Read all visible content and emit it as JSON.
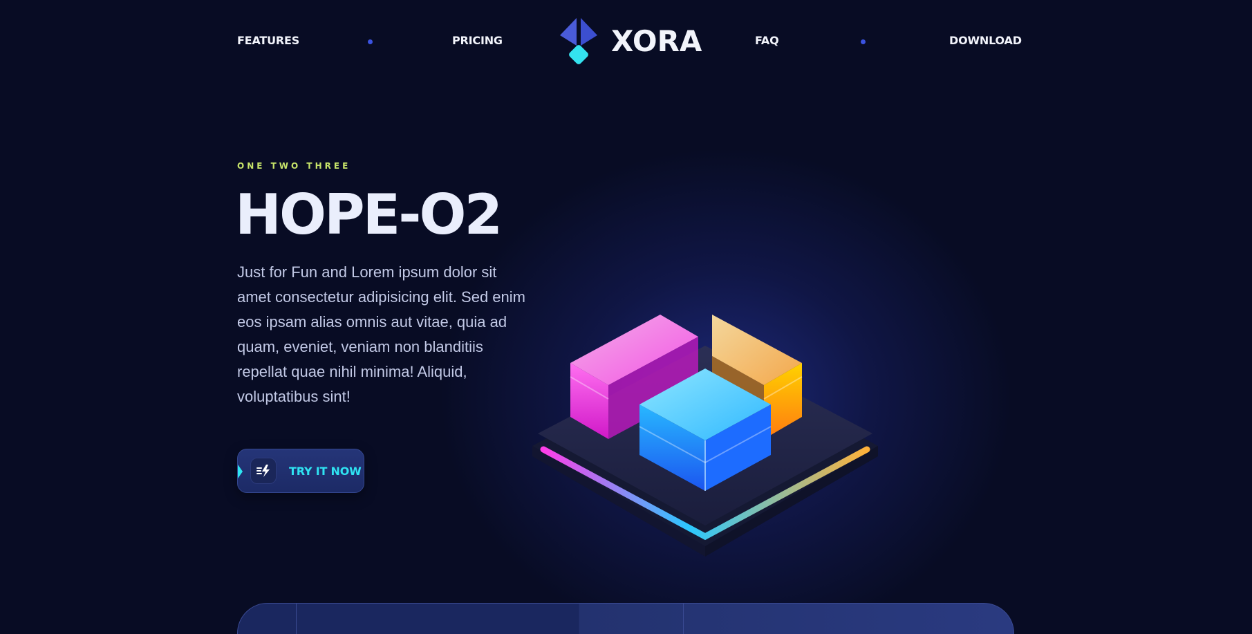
{
  "nav": {
    "left_links": [
      "FEATURES",
      "PRICING"
    ],
    "right_links": [
      "FAQ",
      "DOWNLOAD"
    ],
    "logo_text": "XORA"
  },
  "hero": {
    "eyebrow": "ONE TWO THREE",
    "title": "HOPE-O2",
    "body": "Just for Fun and Lorem ipsum dolor sit amet consectetur adipisicing elit. Sed enim eos ipsam alias omnis aut vitae, quia ad quam, eveniet, veniam non blanditiis repellat quae nihil minima! Aliquid, voluptatibus sint!",
    "cta_label": "TRY IT NOW"
  },
  "colors": {
    "background": "#080c24",
    "accent_cyan": "#2fe3f2",
    "accent_blue": "#3b53e0",
    "eyebrow_green": "#c7e46a",
    "panel_magenta": "#ff3ee8",
    "panel_orange": "#ffb13a",
    "panel_cyan": "#2bc8ff"
  },
  "icons": {
    "logo": "diamond-logo-icon",
    "cta": "lightning-bolt-icon",
    "illustration": "glowing-module-platform-illustration"
  }
}
